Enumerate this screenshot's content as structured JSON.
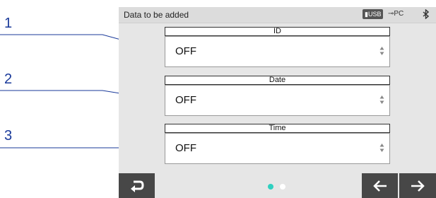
{
  "callouts": [
    "1",
    "2",
    "3"
  ],
  "status": {
    "title": "Data to be added",
    "usb_label": "USB",
    "pc_label": "PC"
  },
  "fields": [
    {
      "label": "ID",
      "value": "OFF"
    },
    {
      "label": "Date",
      "value": "OFF"
    },
    {
      "label": "Time",
      "value": "OFF"
    }
  ],
  "pagination": {
    "total": 2,
    "current": 1
  },
  "colors": {
    "callout": "#1a3a9a",
    "page_dot_active": "#2fd0c0",
    "page_dot_inactive": "#ffffff",
    "nav_button": "#474747"
  },
  "icons": {
    "back": "return-arrow-icon",
    "prev": "arrow-left-icon",
    "next": "arrow-right-icon",
    "bluetooth": "bluetooth-icon",
    "spinner": "spinner-updown-icon"
  }
}
